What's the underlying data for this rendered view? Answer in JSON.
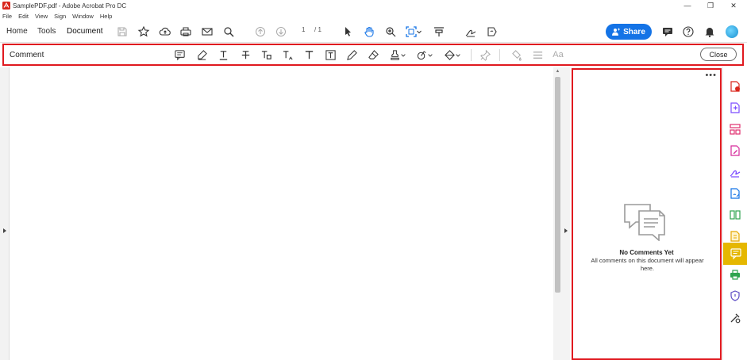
{
  "window": {
    "title": "SamplePDF.pdf - Adobe Acrobat Pro DC",
    "controls": [
      "—",
      "❐",
      "✕"
    ]
  },
  "menu": [
    "File",
    "Edit",
    "View",
    "Sign",
    "Window",
    "Help"
  ],
  "toolbar": {
    "tabs": [
      "Home",
      "Tools",
      "Document"
    ],
    "page_current": "1",
    "page_total": "/ 1",
    "share_label": "Share"
  },
  "comment_toolbar": {
    "label": "Comment",
    "close_label": "Close",
    "text_style_label": "Aa"
  },
  "comment_panel": {
    "more": "•••",
    "empty_title": "No Comments Yet",
    "empty_desc": "All comments on this document will appear here."
  },
  "colors": {
    "accent": "#1473e6",
    "highlight_border": "#e0191f",
    "active_tool": "#e5b700"
  },
  "right_rail_icons": [
    "export-pdf-icon",
    "create-pdf-icon",
    "organize-pages-icon",
    "edit-pdf-icon",
    "fill-sign-icon",
    "send-for-signature-icon",
    "combine-files-icon",
    "more-tools-icon",
    "comment-icon",
    "print-production-icon",
    "protect-icon",
    "more-tools-icon"
  ]
}
